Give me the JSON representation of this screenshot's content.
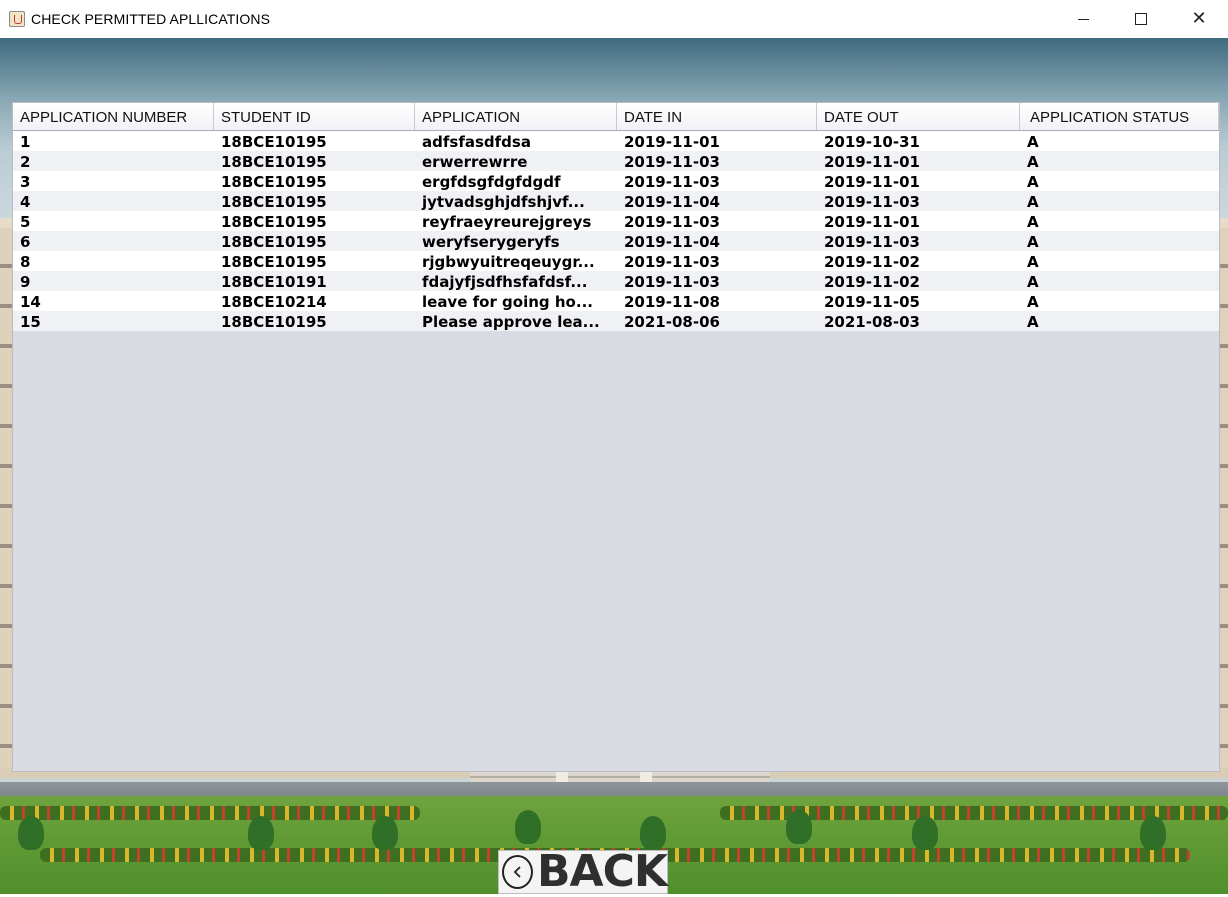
{
  "window": {
    "title": "CHECK PERMITTED APLLICATIONS",
    "icon": "java-cup-icon",
    "controls": [
      "minimize-icon",
      "maximize-icon",
      "close-icon"
    ]
  },
  "table": {
    "columns": [
      "APPLICATION NUMBER",
      "STUDENT ID",
      "APPLICATION",
      "DATE IN",
      "DATE OUT",
      "APPLICATION STATUS"
    ],
    "rows": [
      [
        "1",
        "18BCE10195",
        "adfsfasdfdsa",
        "2019-11-01",
        "2019-10-31",
        "A"
      ],
      [
        "2",
        "18BCE10195",
        "erwerrewrre",
        "2019-11-03",
        "2019-11-01",
        "A"
      ],
      [
        "3",
        "18BCE10195",
        "ergfdsgfdgfdgdf",
        "2019-11-03",
        "2019-11-01",
        "A"
      ],
      [
        "4",
        "18BCE10195",
        "jytvadsghjdfshjvf...",
        "2019-11-04",
        "2019-11-03",
        "A"
      ],
      [
        "5",
        "18BCE10195",
        "reyfraeyreurejgreys",
        "2019-11-03",
        "2019-11-01",
        "A"
      ],
      [
        "6",
        "18BCE10195",
        "weryfserygeryfs",
        "2019-11-04",
        "2019-11-03",
        "A"
      ],
      [
        "8",
        "18BCE10195",
        "rjgbwyuitreqeuygr...",
        "2019-11-03",
        "2019-11-02",
        "A"
      ],
      [
        "9",
        "18BCE10191",
        "fdajyfjsdfhsfafdsf...",
        "2019-11-03",
        "2019-11-02",
        "A"
      ],
      [
        "14",
        "18BCE10214",
        "leave for going ho...",
        "2019-11-08",
        "2019-11-05",
        "A"
      ],
      [
        "15",
        "18BCE10195",
        "Please approve lea...",
        "2021-08-06",
        "2021-08-03",
        "A"
      ]
    ]
  },
  "back_button": {
    "label": "BACK",
    "icon": "chevron-left-circle-icon"
  },
  "colors": {
    "table_background": "#d8dbe2",
    "row_alt": "#f0f1f4",
    "header_background": "#f1f2f5"
  }
}
